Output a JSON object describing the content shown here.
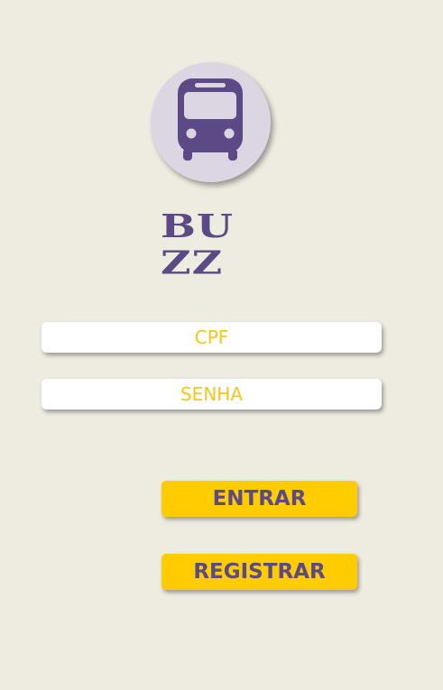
{
  "app": {
    "logo_icon": "bus-icon",
    "brand_line1": "BU",
    "brand_line2": "ZZ"
  },
  "login": {
    "cpf_placeholder": "CPF",
    "senha_placeholder": "SENHA",
    "entrar_label": "ENTRAR",
    "registrar_label": "REGISTRAR"
  },
  "colors": {
    "background": "#eeebe1",
    "brand_purple": "#5b4a85",
    "accent_yellow": "#ffcc00",
    "placeholder_yellow": "#f5c518",
    "logo_circle": "#dcd6e3"
  }
}
